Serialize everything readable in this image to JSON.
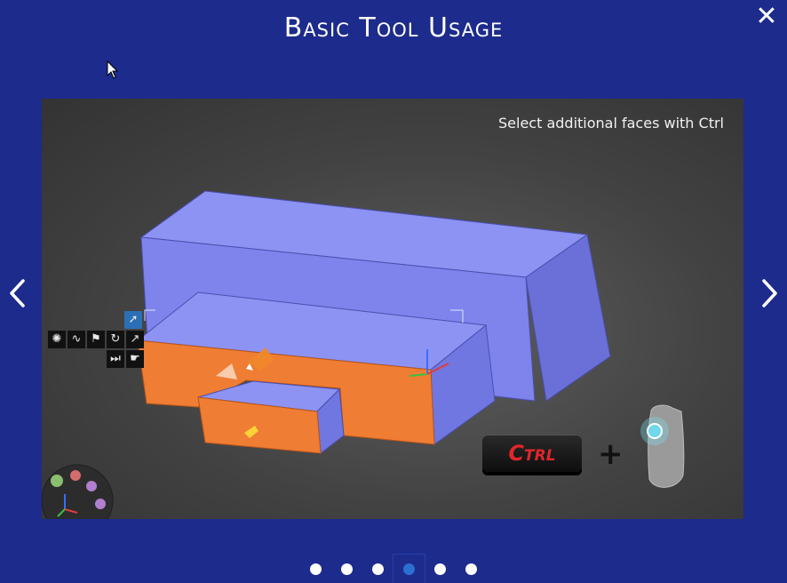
{
  "dialog": {
    "title": "Basic Tool Usage",
    "close_label": "✕"
  },
  "slide": {
    "caption": "Select additional faces with Ctrl",
    "key_label": "Ctrl",
    "plus_label": "+"
  },
  "pagination": {
    "total": 6,
    "active_index": 3
  },
  "colors": {
    "background": "#1c2b8c",
    "selected_face": "#ef7d33",
    "unselected_face": "#7f86ee",
    "key_text": "#e0262c"
  },
  "icons": {
    "prev": "chevron-left-icon",
    "next": "chevron-right-icon",
    "close": "close-icon"
  }
}
